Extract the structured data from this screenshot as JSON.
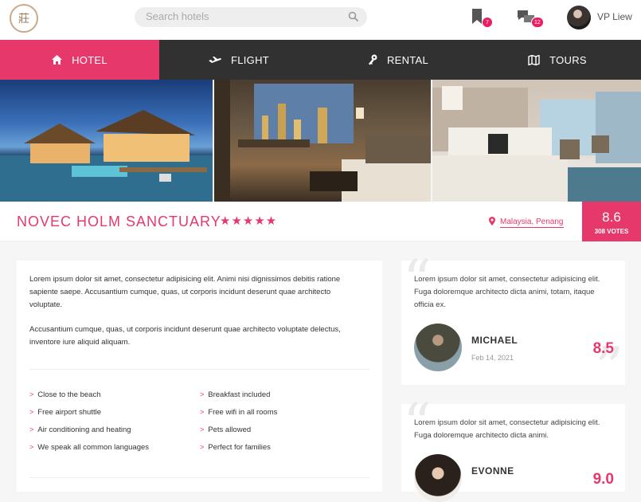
{
  "header": {
    "logo_text": "莊",
    "search_placeholder": "Search hotels",
    "bookmark_count": "7",
    "messages_count": "12",
    "username": "VP Liew"
  },
  "nav": {
    "items": [
      {
        "label": "HOTEL",
        "icon": "home-icon",
        "active": true
      },
      {
        "label": "FLIGHT",
        "icon": "plane-icon",
        "active": false
      },
      {
        "label": "RENTAL",
        "icon": "key-icon",
        "active": false
      },
      {
        "label": "TOURS",
        "icon": "map-icon",
        "active": false
      }
    ]
  },
  "hotel": {
    "name": "NOVEC HOLM SANCTUARY",
    "stars": "★★★★★",
    "rating_stars": 5,
    "location": "Malaysia, Penang",
    "score": "8.6",
    "votes": "308 VOTES"
  },
  "description": {
    "p1": "Lorem ipsum dolor sit amet, consectetur adipisicing elit. Animi nisi dignissimos debitis ratione sapiente saepe. Accusantium cumque, quas, ut corporis incidunt deserunt quae architecto voluptate.",
    "p2": "Accusantium cumque, quas, ut corporis incidunt deserunt quae architecto voluptate delectus, inventore iure aliquid aliquam."
  },
  "features": {
    "left": [
      "Close to the beach",
      "Free airport shuttle",
      "Air conditioning and heating",
      "We speak all common languages"
    ],
    "right": [
      "Breakfast included",
      "Free wifi in all rooms",
      "Pets allowed",
      "Perfect for families"
    ]
  },
  "reviews": [
    {
      "text": "Lorem ipsum dolor sit amet, consectetur adipisicing elit. Fuga doloremque architecto dicta animi, totam, itaque officia ex.",
      "name": "MICHAEL",
      "date": "Feb 14, 2021",
      "score": "8.5"
    },
    {
      "text": "Lorem ipsum dolor sit amet, consectetur adipisicing elit. Fuga doloremque architecto dicta animi.",
      "name": "EVONNE",
      "date": "",
      "score": "9.0"
    }
  ],
  "colors": {
    "accent": "#e7386b",
    "nav_bg": "#313131"
  }
}
